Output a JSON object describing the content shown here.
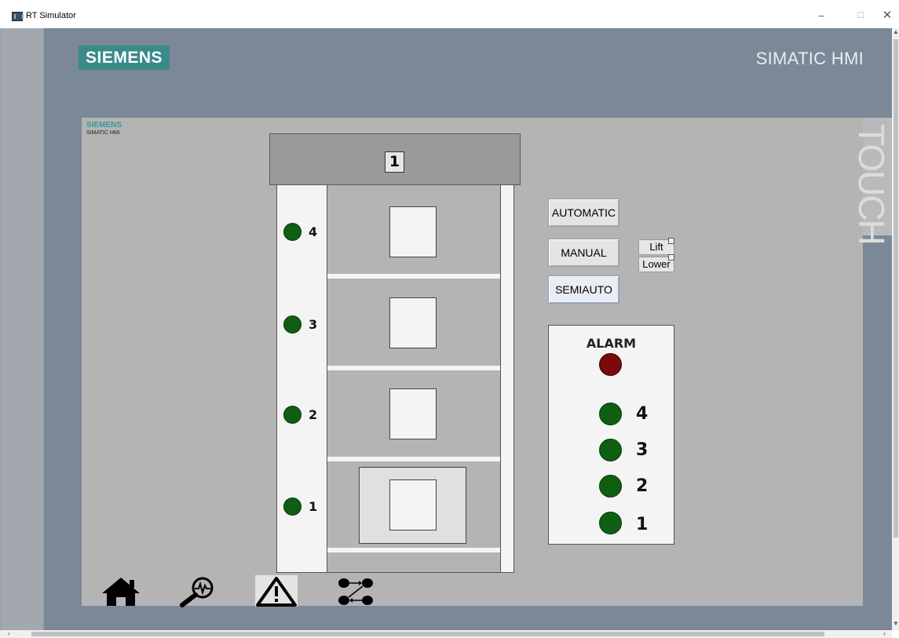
{
  "window": {
    "title": "RT Simulator",
    "minimize": "–",
    "maximize": "☐",
    "close": "✕"
  },
  "header": {
    "brand": "SIEMENS",
    "product": "SIMATIC HMI",
    "touch_label": "TOUCH"
  },
  "screen": {
    "mini_brand": "SIEMENS",
    "mini_product": "SIMATIC HMI",
    "current_floor": "1",
    "floors": [
      {
        "label": "4"
      },
      {
        "label": "3"
      },
      {
        "label": "2"
      },
      {
        "label": "1"
      }
    ],
    "cabin_floor": 1,
    "modes": {
      "automatic": "AUTOMATIC",
      "manual": "MANUAL",
      "semiauto": "SEMIAUTO",
      "selected": "SEMIAUTO"
    },
    "manual_controls": {
      "lift": "Lift",
      "lower": "Lower"
    },
    "alarm": {
      "title": "ALARM",
      "alarm_lamp_color": "#7a0a0a",
      "floor_lamps": [
        "4",
        "3",
        "2",
        "1"
      ]
    }
  },
  "colors": {
    "lamp_on": "#0f5f13",
    "brand_teal": "#3a8a8a",
    "panel_background": "#7b8897"
  },
  "nav": {
    "items": [
      "home-icon",
      "diagnostics-search-icon",
      "warning-icon",
      "network-icon"
    ]
  }
}
